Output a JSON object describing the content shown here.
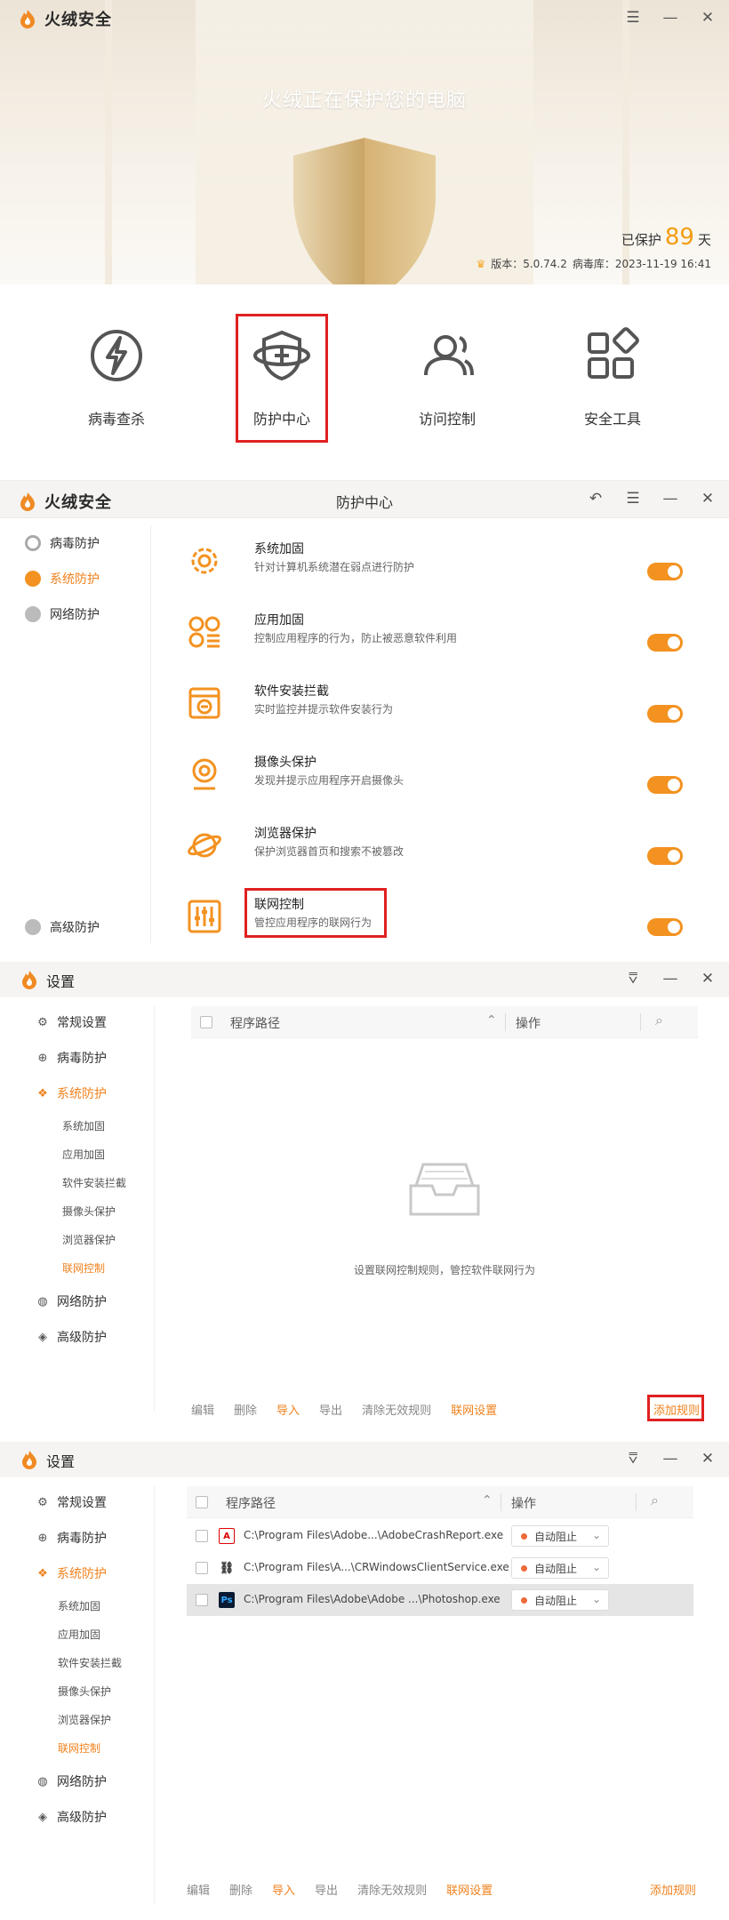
{
  "app": {
    "brand": "火绒安全"
  },
  "home": {
    "title": "火绒正在保护您的电脑",
    "protected_prefix": "已保护",
    "protected_days": "89",
    "protected_suffix": "天",
    "version": "版本：5.0.74.2",
    "virus_db": "病毒库：2023-11-19 16:41",
    "tiles": [
      {
        "label": "病毒查杀",
        "icon": "lightning-icon"
      },
      {
        "label": "防护中心",
        "icon": "shield-planet-icon"
      },
      {
        "label": "访问控制",
        "icon": "users-icon"
      },
      {
        "label": "安全工具",
        "icon": "grid-icon"
      }
    ]
  },
  "protect_center": {
    "title": "防护中心",
    "sidebar": [
      {
        "label": "病毒防护"
      },
      {
        "label": "系统防护",
        "active": true
      },
      {
        "label": "网络防护"
      },
      {
        "label": "高级防护"
      }
    ],
    "features": [
      {
        "title": "系统加固",
        "desc": "针对计算机系统潜在弱点进行防护"
      },
      {
        "title": "应用加固",
        "desc": "控制应用程序的行为，防止被恶意软件利用"
      },
      {
        "title": "软件安装拦截",
        "desc": "实时监控并提示软件安装行为"
      },
      {
        "title": "摄像头保护",
        "desc": "发现并提示应用程序开启摄像头"
      },
      {
        "title": "浏览器保护",
        "desc": "保护浏览器首页和搜索不被篡改"
      },
      {
        "title": "联网控制",
        "desc": "管控应用程序的联网行为"
      }
    ]
  },
  "settings": {
    "title": "设置",
    "nav": [
      "常规设置",
      "病毒防护",
      "系统防护",
      "网络防护",
      "高级防护"
    ],
    "sub": [
      "系统加固",
      "应用加固",
      "软件安装拦截",
      "摄像头保护",
      "浏览器保护",
      "联网控制"
    ],
    "col_path": "程序路径",
    "col_action": "操作",
    "empty_text": "设置联网控制规则，管控软件联网行为",
    "footer": [
      "编辑",
      "删除",
      "导入",
      "导出",
      "清除无效规则",
      "联网设置"
    ],
    "add_rule": "添加规则",
    "rows": [
      {
        "path": "C:\\Program Files\\Adobe...\\AdobeCrashReport.exe",
        "action": "自动阻止"
      },
      {
        "path": "C:\\Program Files\\A...\\CRWindowsClientService.exe",
        "action": "自动阻止"
      },
      {
        "path": "C:\\Program Files\\Adobe\\Adobe ...\\Photoshop.exe",
        "action": "自动阻止"
      }
    ]
  },
  "colors": {
    "accent": "#f39220",
    "highlight": "#e02020"
  }
}
